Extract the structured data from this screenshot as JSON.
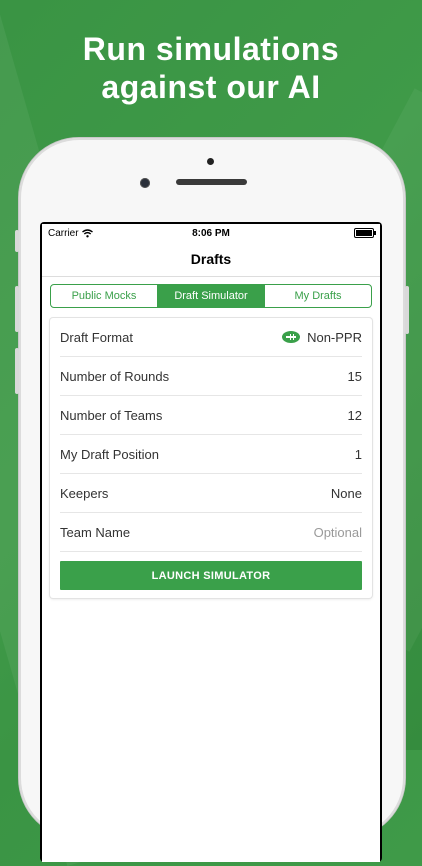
{
  "headline": {
    "line1": "Run simulations",
    "line2": "against our AI"
  },
  "status_bar": {
    "carrier": "Carrier",
    "time": "8:06 PM",
    "wifi_icon": "wifi-icon",
    "battery_icon": "battery-icon"
  },
  "nav": {
    "title": "Drafts"
  },
  "tabs": [
    {
      "label": "Public Mocks",
      "active": false
    },
    {
      "label": "Draft Simulator",
      "active": true
    },
    {
      "label": "My Drafts",
      "active": false
    }
  ],
  "settings": [
    {
      "label": "Draft Format",
      "value": "Non-PPR",
      "icon": "football-icon"
    },
    {
      "label": "Number of Rounds",
      "value": "15"
    },
    {
      "label": "Number of Teams",
      "value": "12"
    },
    {
      "label": "My Draft Position",
      "value": "1"
    },
    {
      "label": "Keepers",
      "value": "None"
    },
    {
      "label": "Team Name",
      "placeholder": "Optional"
    }
  ],
  "launch_button": {
    "label": "LAUNCH SIMULATOR"
  },
  "colors": {
    "accent": "#3aa04a",
    "background": "#3f9a48"
  }
}
